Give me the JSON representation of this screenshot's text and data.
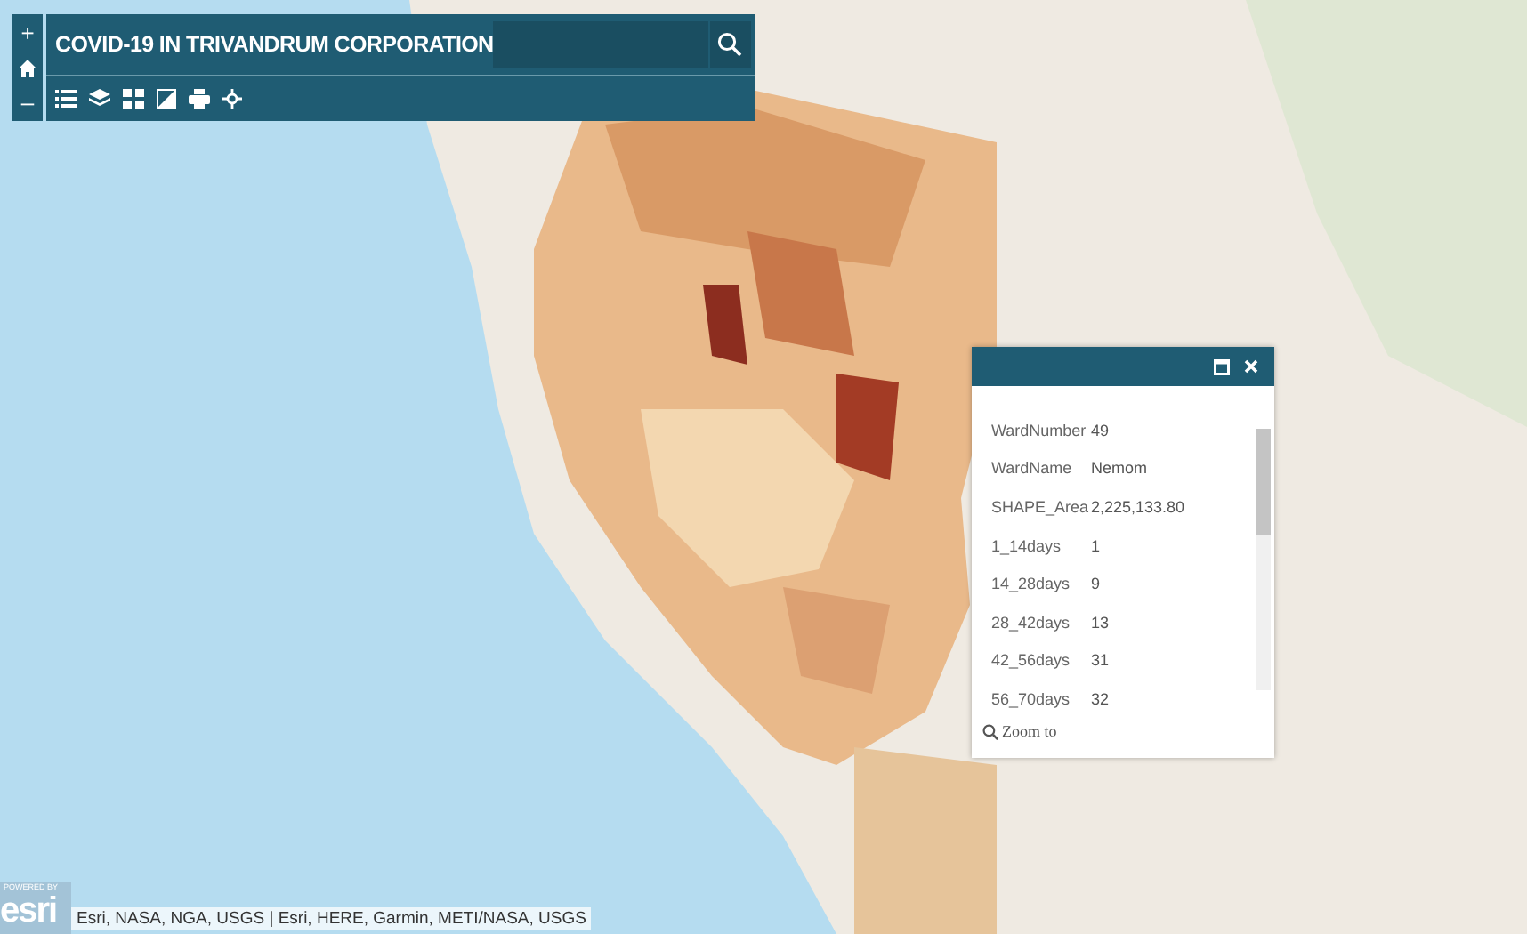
{
  "zoom_controls": {
    "zoom_in": "+",
    "zoom_out": "–"
  },
  "header": {
    "title": "COVID-19 IN TRIVANDRUM CORPORATION"
  },
  "popup": {
    "fields": [
      {
        "label": "WardNumber",
        "value": "49"
      },
      {
        "label": "WardName",
        "value": "Nemom"
      },
      {
        "label": "SHAPE_Area",
        "value": "2,225,133.80"
      },
      {
        "label": "1_14days",
        "value": "1"
      },
      {
        "label": "14_28days",
        "value": "9"
      },
      {
        "label": "28_42days",
        "value": "13"
      },
      {
        "label": "42_56days",
        "value": "31"
      },
      {
        "label": "56_70days",
        "value": "32"
      }
    ],
    "action": "Zoom to"
  },
  "attribution": {
    "logo_caption": "POWERED BY",
    "logo": "esri",
    "text": "Esri, NASA, NGA, USGS | Esri, HERE, Garmin, METI/NASA, USGS"
  }
}
